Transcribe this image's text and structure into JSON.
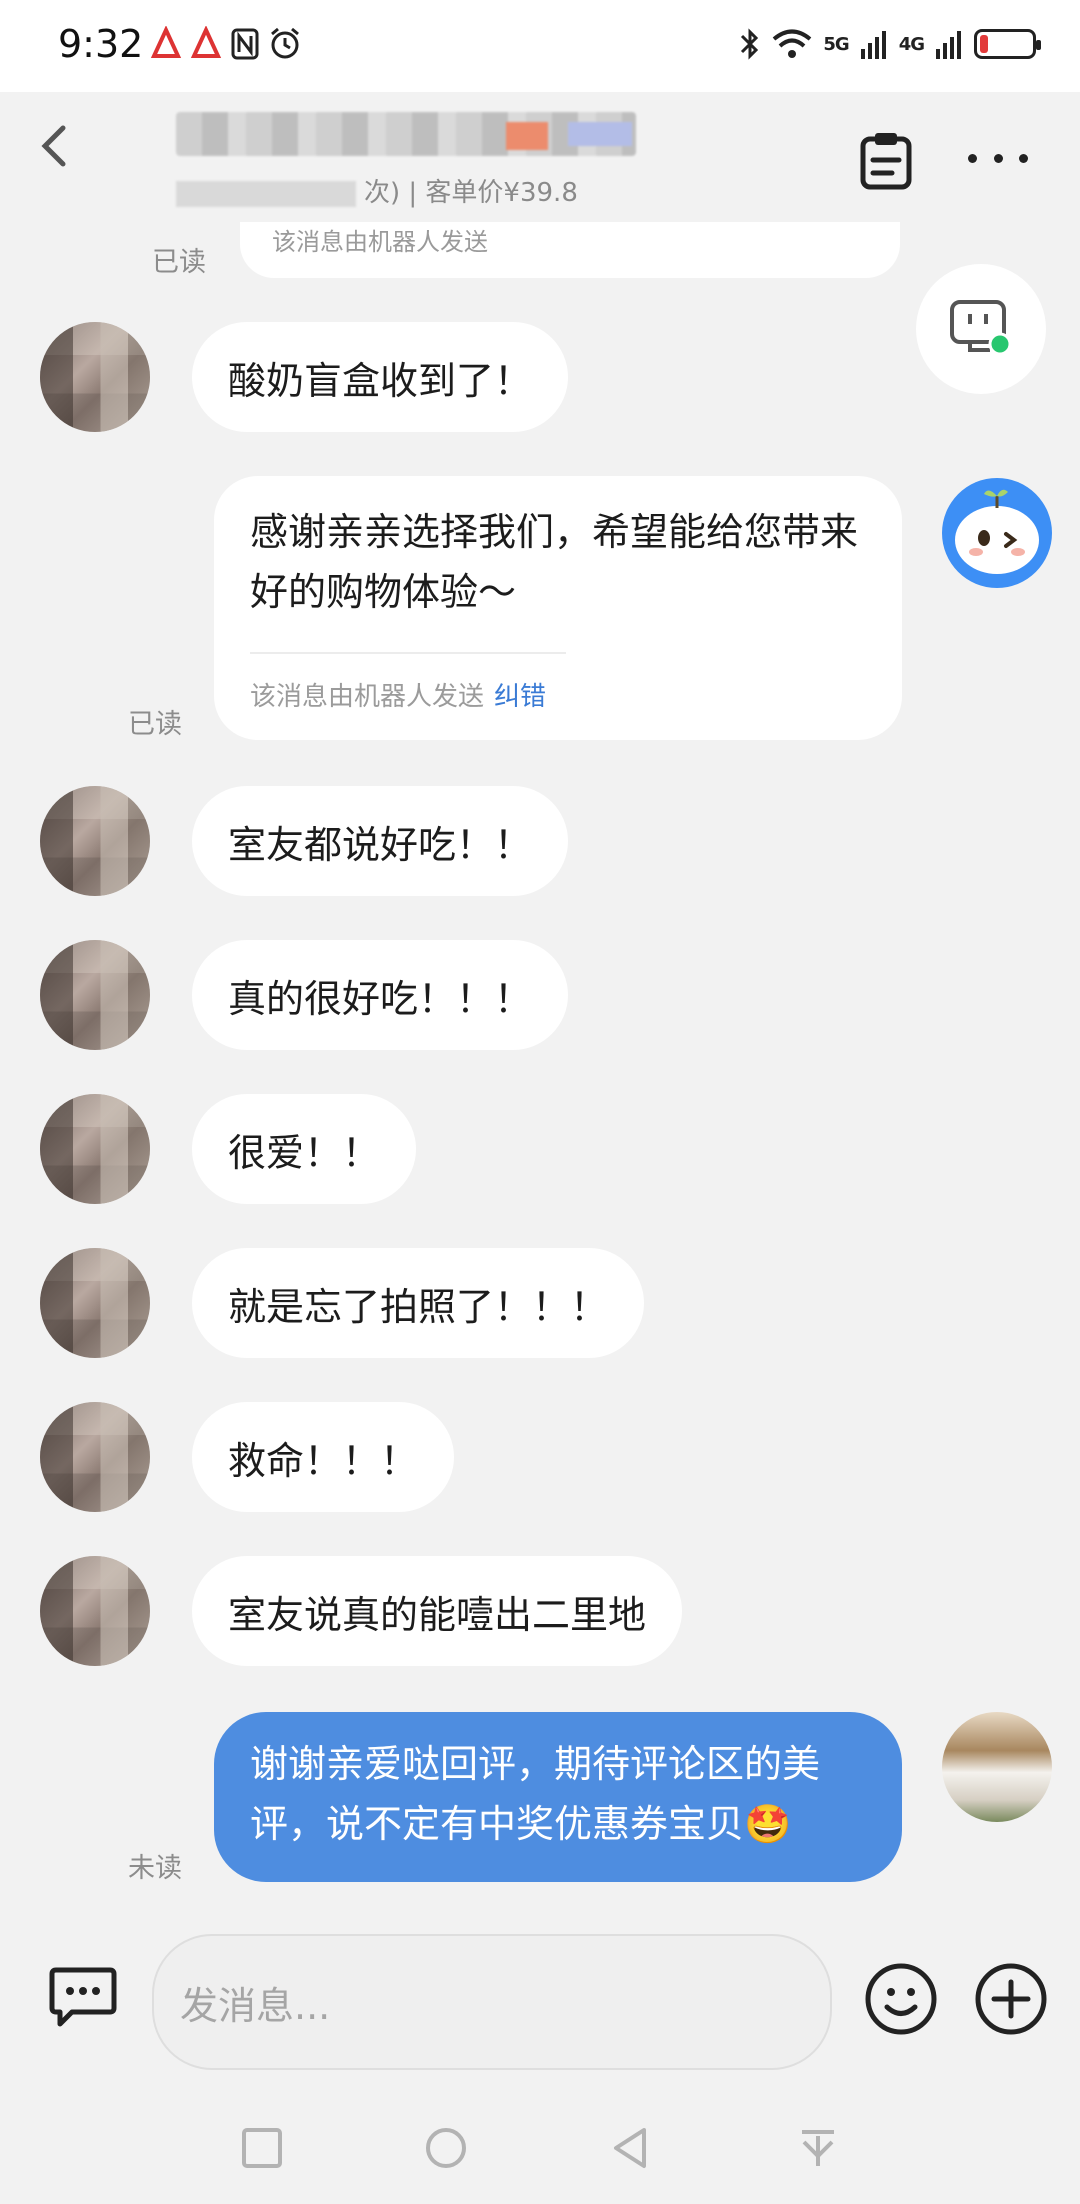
{
  "status_bar": {
    "time": "9:32",
    "signal_5g": "5G",
    "signal_4g": "4G"
  },
  "header": {
    "subtitle": "次) | 客单价¥39.8"
  },
  "messages": {
    "top_partial_note": "该消息由机器人发送",
    "read_label_1": "已读",
    "customer_1": "酸奶盲盒收到了！",
    "bot_reply": "感谢亲亲选择我们，希望能给您带来好的购物体验～",
    "bot_note": "该消息由机器人发送",
    "bot_fix": "纠错",
    "read_label_2": "已读",
    "customer_2": "室友都说好吃！！",
    "customer_3": "真的很好吃！！！",
    "customer_4": "很爱！！",
    "customer_5": "就是忘了拍照了！！！",
    "customer_6": "救命！！！",
    "customer_7": "室友说真的能噎出二里地",
    "my_reply": "谢谢亲爱哒回评，期待评论区的美评，说不定有中奖优惠券宝贝🤩",
    "unread_label": "未读"
  },
  "input": {
    "placeholder": "发消息..."
  },
  "colors": {
    "accent_blue": "#4e8de0",
    "link_blue": "#3a7bd5",
    "background": "#f2f2f2",
    "bubble_white": "#ffffff"
  },
  "icons": [
    "back-icon",
    "clipboard-icon",
    "more-icon",
    "robot-icon",
    "chat-icon",
    "emoji-icon",
    "plus-icon",
    "nav-square-icon",
    "nav-circle-icon",
    "nav-back-icon",
    "nav-down-icon"
  ]
}
